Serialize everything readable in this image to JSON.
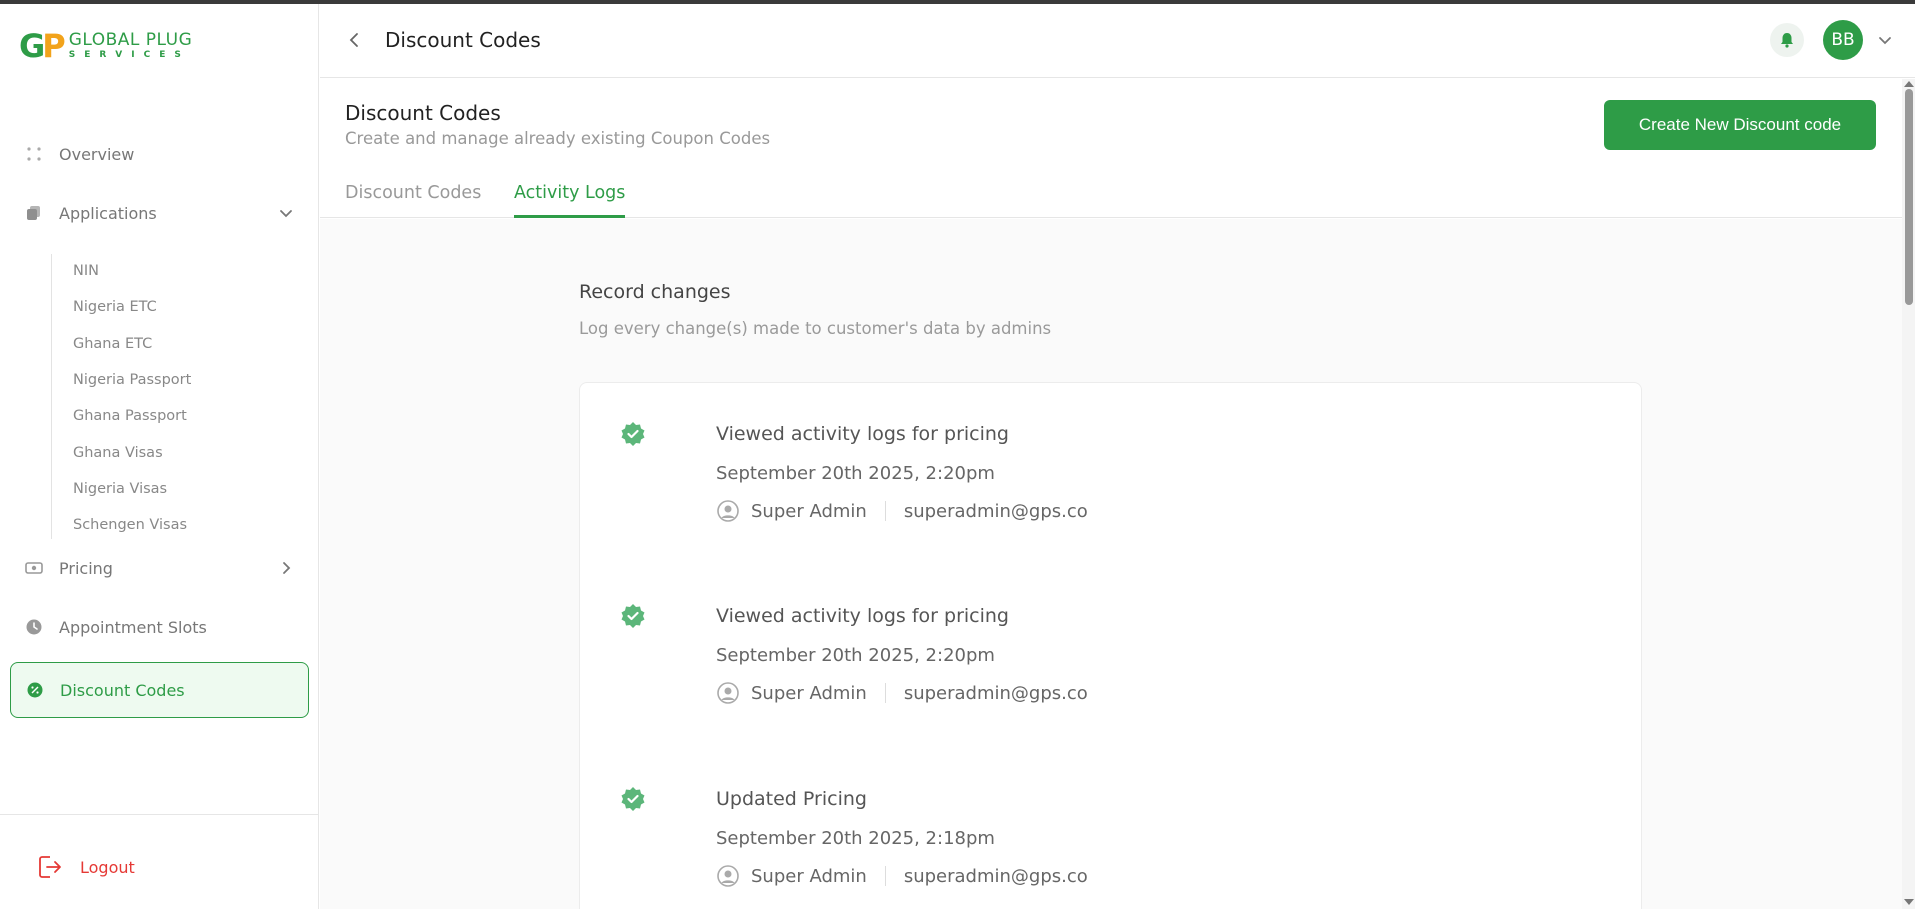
{
  "brand": {
    "mark_g": "G",
    "mark_p": "P",
    "name_line1": "GLOBAL PLUG",
    "name_line2": "SERVICES",
    "primary_color": "#2e9c47",
    "accent_color": "#f2a31b"
  },
  "sidebar": {
    "items": [
      {
        "label": "Overview",
        "icon": "grid-dots-icon"
      },
      {
        "label": "Applications",
        "icon": "documents-icon",
        "expanded": true
      },
      {
        "label": "Pricing",
        "icon": "money-icon"
      },
      {
        "label": "Appointment Slots",
        "icon": "clock-icon"
      },
      {
        "label": "Discount Codes",
        "icon": "discount-badge-icon",
        "active": true
      }
    ],
    "subitems": [
      "NIN",
      "Nigeria ETC",
      "Ghana ETC",
      "Nigeria Passport",
      "Ghana Passport",
      "Ghana Visas",
      "Nigeria Visas",
      "Schengen Visas"
    ],
    "logout_label": "Logout"
  },
  "header": {
    "title": "Discount Codes",
    "avatar_initials": "BB"
  },
  "page": {
    "title": "Discount Codes",
    "subtitle": "Create and manage already existing Coupon Codes",
    "create_button": "Create New Discount code",
    "tabs": [
      {
        "label": "Discount Codes",
        "active": false
      },
      {
        "label": "Activity Logs",
        "active": true
      }
    ]
  },
  "activity": {
    "title": "Record changes",
    "subtitle": "Log every change(s) made to customer's data by admins",
    "logs": [
      {
        "action": "Viewed activity logs for pricing",
        "time": "September 20th 2025, 2:20pm",
        "user": "Super Admin",
        "email": "superadmin@gps.co"
      },
      {
        "action": "Viewed activity logs for pricing",
        "time": "September 20th 2025, 2:20pm",
        "user": "Super Admin",
        "email": "superadmin@gps.co"
      },
      {
        "action": "Updated Pricing",
        "time": "September 20th 2025, 2:18pm",
        "user": "Super Admin",
        "email": "superadmin@gps.co"
      }
    ]
  }
}
